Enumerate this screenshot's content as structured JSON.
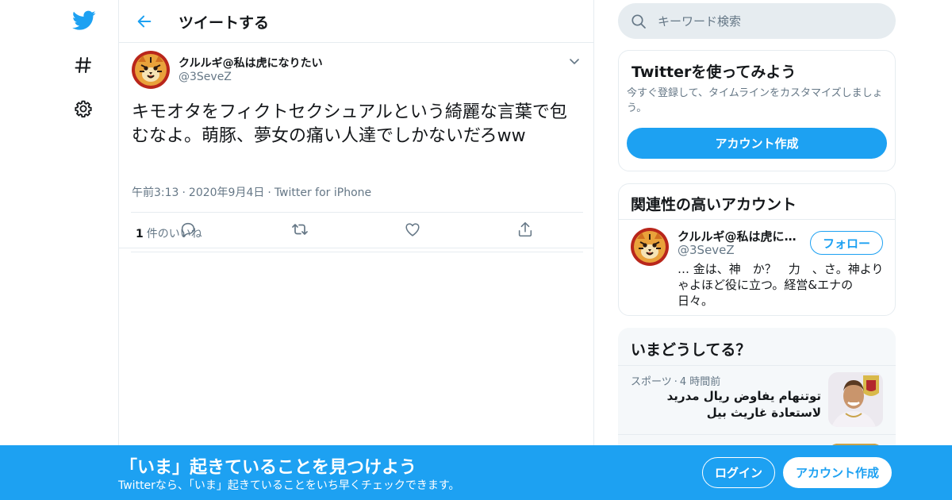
{
  "nav": {
    "icons": [
      "twitter-bird-icon",
      "hashtag-icon",
      "gear-icon"
    ]
  },
  "header": {
    "title": "ツイートする"
  },
  "tweet": {
    "display_name": "クルルギ@私は虎になりたい",
    "handle": "@3SeveZ",
    "text": "キモオタをフィクトセクシュアルという綺麗な言葉で包むなよ。萌豚、夢女の痛い人達でしかないだろww",
    "time": "午前3:13",
    "date": "2020年9月4日",
    "source": "Twitter for iPhone",
    "like_count": "1",
    "like_label": "件のいいね"
  },
  "search": {
    "placeholder": "キーワード検索"
  },
  "signup_card": {
    "title": "Twitterを使ってみよう",
    "description": "今すぐ登録して、タイムラインをカスタマイズしましょう。",
    "button_label": "アカウント作成"
  },
  "related_card": {
    "title": "関連性の高いアカウント",
    "name": "クルルギ@私は虎になりたい",
    "handle": "@3SeveZ",
    "follow_label": "フォロー",
    "bio": "… 金は、神　か？　力　、さ。神よりゃよほど役に立つ。経営&エナの日々。"
  },
  "trends_card": {
    "title": "いまどうしてる？",
    "items": [
      {
        "category": "スポーツ",
        "time": "4 時間前",
        "text": "توتنهام يفاوض ريال مدريد لاستعادة غاريث بيل"
      }
    ]
  },
  "bottom_bar": {
    "title": "「いま」起きていることを見つけよう",
    "subtitle": "Twitterなら、「いま」起きていることをいち早くチェックできます。",
    "login_label": "ログイン",
    "signup_label": "アカウント作成"
  },
  "colors": {
    "brand": "#1da1f2",
    "text": "#14171a",
    "muted": "#657786",
    "border": "#e6ecf0",
    "surface": "#f5f8fa"
  }
}
